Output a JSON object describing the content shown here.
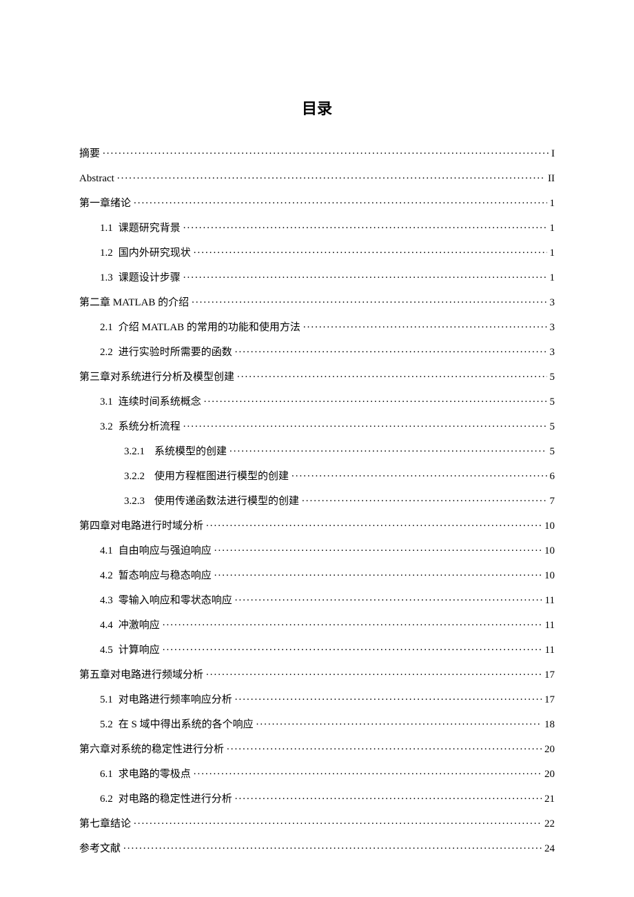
{
  "title": "目录",
  "toc": [
    {
      "level": 0,
      "num": "",
      "text": "摘要",
      "page": "I"
    },
    {
      "level": 0,
      "num": "",
      "text": "Abstract",
      "page": "II"
    },
    {
      "level": 0,
      "num": "",
      "text": "第一章绪论",
      "page": "1"
    },
    {
      "level": 1,
      "num": "1.1",
      "text": "课题研究背景",
      "page": "1"
    },
    {
      "level": 1,
      "num": "1.2",
      "text": "国内外研究现状",
      "page": "1"
    },
    {
      "level": 1,
      "num": "1.3",
      "text": "课题设计步骤",
      "page": "1"
    },
    {
      "level": 0,
      "num": "",
      "text": "第二章 MATLAB 的介绍",
      "page": "3"
    },
    {
      "level": 1,
      "num": "2.1",
      "text": "介绍 MATLAB 的常用的功能和使用方法",
      "page": "3"
    },
    {
      "level": 1,
      "num": "2.2",
      "text": "进行实验时所需要的函数",
      "page": "3"
    },
    {
      "level": 0,
      "num": "",
      "text": "第三章对系统进行分析及模型创建",
      "page": "5"
    },
    {
      "level": 1,
      "num": "3.1",
      "text": "连续时间系统概念",
      "page": "5"
    },
    {
      "level": 1,
      "num": "3.2",
      "text": "系统分析流程",
      "page": "5"
    },
    {
      "level": 2,
      "num": "3.2.1",
      "text": "系统模型的创建",
      "page": "5"
    },
    {
      "level": 2,
      "num": "3.2.2",
      "text": "使用方程框图进行模型的创建",
      "page": "6"
    },
    {
      "level": 2,
      "num": "3.2.3",
      "text": "使用传递函数法进行模型的创建",
      "page": "7"
    },
    {
      "level": 0,
      "num": "",
      "text": "第四章对电路进行时域分析",
      "page": "10"
    },
    {
      "level": 1,
      "num": "4.1",
      "text": "自由响应与强迫响应",
      "page": "10"
    },
    {
      "level": 1,
      "num": "4.2",
      "text": "暂态响应与稳态响应",
      "page": "10"
    },
    {
      "level": 1,
      "num": "4.3",
      "text": "零输入响应和零状态响应",
      "page": "11"
    },
    {
      "level": 1,
      "num": "4.4",
      "text": "冲激响应",
      "page": "11"
    },
    {
      "level": 1,
      "num": "4.5",
      "text": "计算响应",
      "page": "11"
    },
    {
      "level": 0,
      "num": "",
      "text": "第五章对电路进行频域分析",
      "page": "17"
    },
    {
      "level": 1,
      "num": "5.1",
      "text": "对电路进行频率响应分析",
      "page": "17"
    },
    {
      "level": 1,
      "num": "5.2",
      "text": "在 S 域中得出系统的各个响应",
      "page": "18"
    },
    {
      "level": 0,
      "num": "",
      "text": "第六章对系统的稳定性进行分析",
      "page": "20"
    },
    {
      "level": 1,
      "num": "6.1",
      "text": "求电路的零极点",
      "page": "20"
    },
    {
      "level": 1,
      "num": "6.2",
      "text": "对电路的稳定性进行分析",
      "page": "21"
    },
    {
      "level": 0,
      "num": "",
      "text": "第七章结论",
      "page": "22"
    },
    {
      "level": 0,
      "num": "",
      "text": "参考文献",
      "page": "24"
    }
  ]
}
